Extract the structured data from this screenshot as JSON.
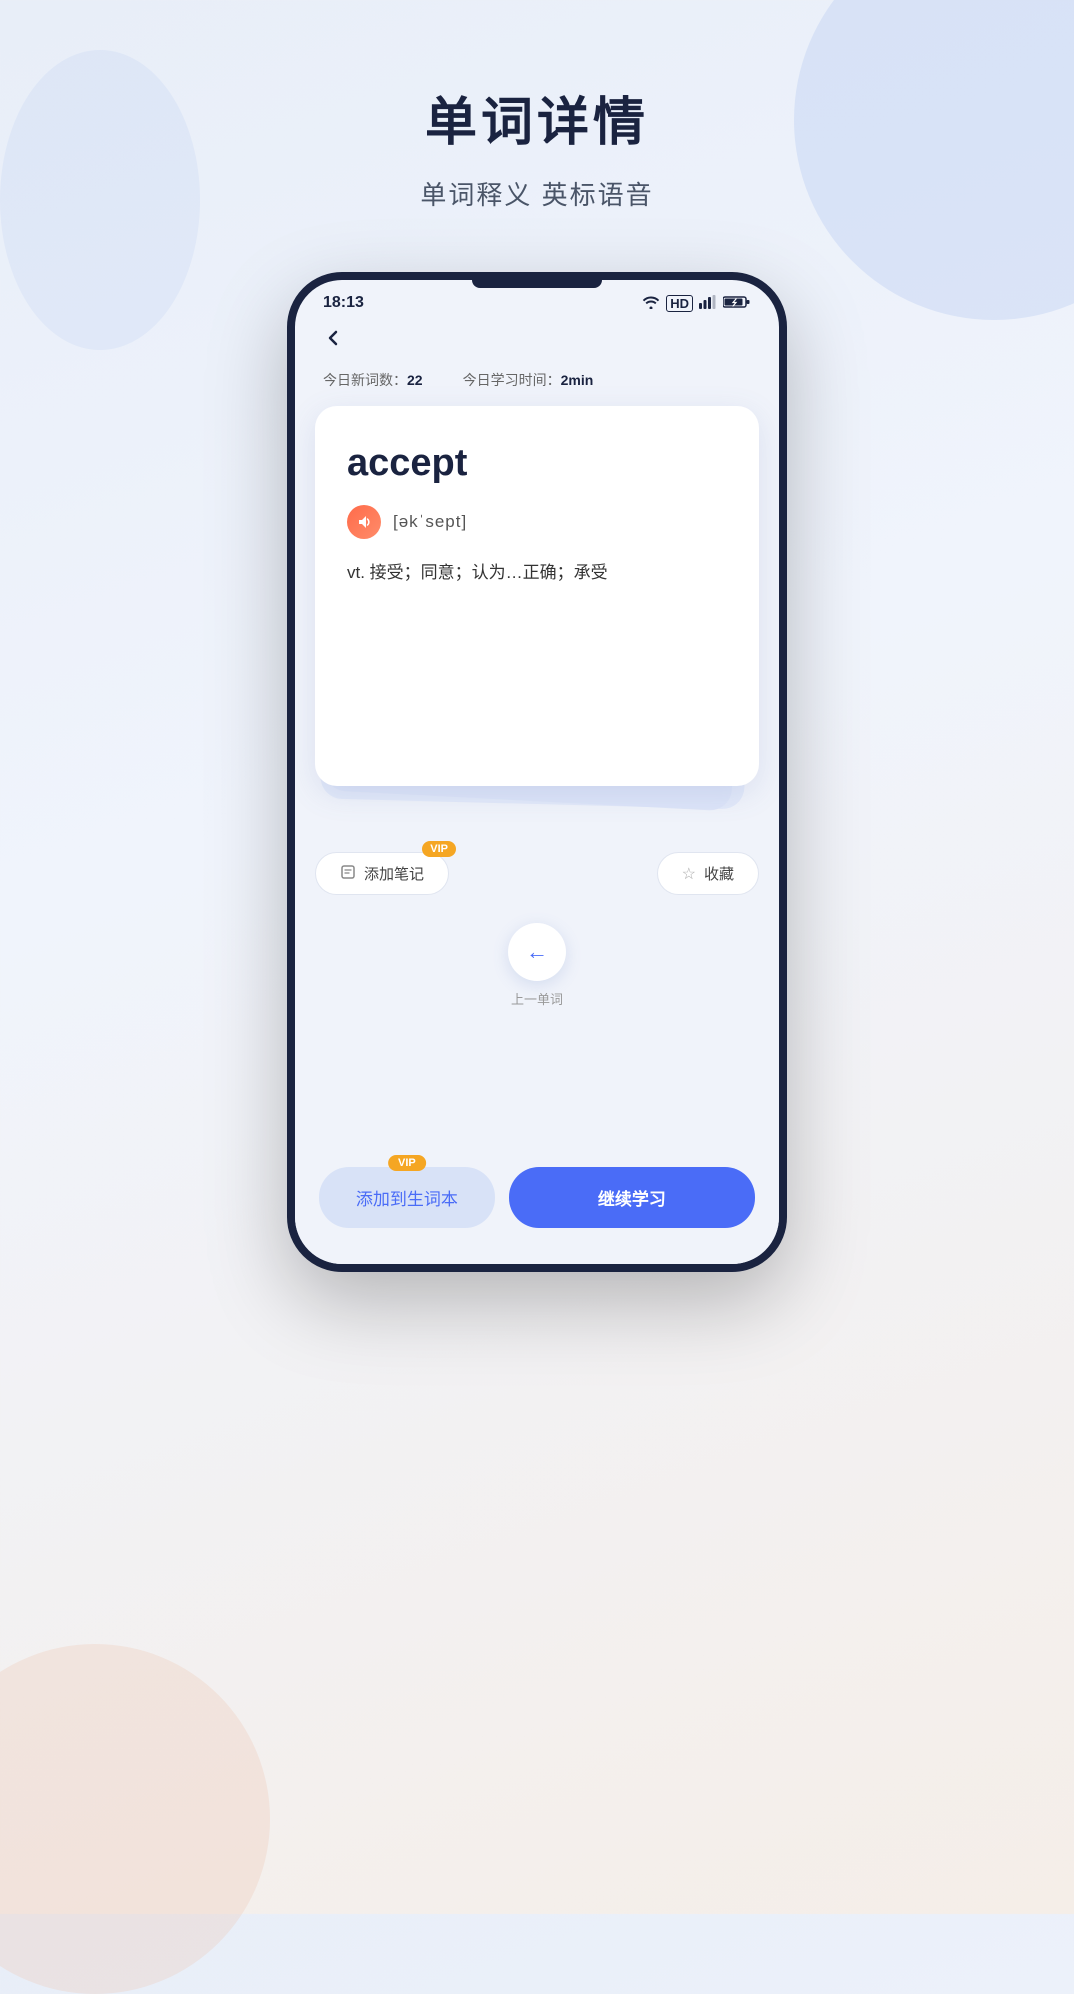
{
  "page": {
    "title": "单词详情",
    "subtitle": "单词释义 英标语音",
    "background_colors": {
      "top": "#e8eef8",
      "mid": "#f0f4fc",
      "bottom": "#f5eee8"
    }
  },
  "status_bar": {
    "time": "18:13",
    "hd": "HD",
    "wifi_icon": "wifi",
    "signal_icon": "signal",
    "battery_icon": "battery"
  },
  "stats": {
    "new_words_label": "今日新词数：",
    "new_words_value": "22",
    "study_time_label": "今日学习时间：",
    "study_time_value": "2min"
  },
  "word_card": {
    "word": "accept",
    "phonetic": "[əkˈsept]",
    "definition": "vt. 接受；同意；认为…正确；承受",
    "sound_icon": "🔊"
  },
  "actions": {
    "add_note_label": "添加笔记",
    "add_note_vip": "VIP",
    "collect_label": "收藏"
  },
  "navigation": {
    "prev_label": "上一单词",
    "arrow": "←"
  },
  "bottom": {
    "add_vocab_label": "添加到生词本",
    "add_vocab_vip": "VIP",
    "continue_label": "继续学习"
  }
}
